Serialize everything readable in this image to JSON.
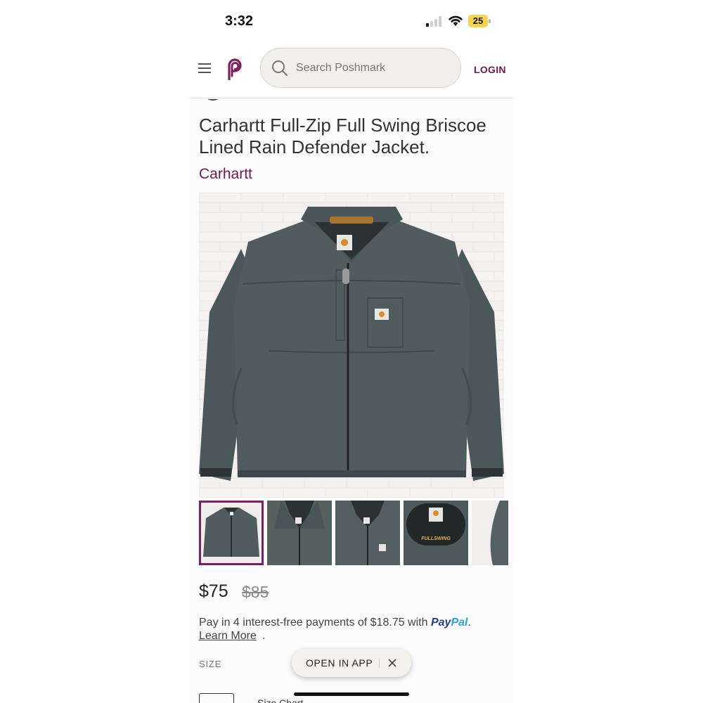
{
  "status_bar": {
    "time": "3:32",
    "battery": "25"
  },
  "header": {
    "search_placeholder": "Search Poshmark",
    "login_label": "LOGIN"
  },
  "listing": {
    "title": "Carhartt Full-Zip Full Swing Briscoe Lined Rain Defender Jacket.",
    "brand": "Carhartt",
    "price": "$75",
    "original_price": "$85",
    "installment_text": "Pay in 4 interest-free payments of $18.75 with",
    "paypal_part1": "Pay",
    "paypal_part2": "Pal",
    "installment_end": ".",
    "learn_more": "Learn More",
    "learn_more_end": ".",
    "size_label": "SIZE",
    "size_chart": "Size Chart",
    "thumbnail_label": "FULLSWING"
  },
  "banner": {
    "open_in_app": "OPEN IN APP"
  },
  "colors": {
    "accent": "#6e1a4f",
    "paypal_dark": "#233e8b",
    "paypal_light": "#2aa1e0",
    "jacket": "#4f5a5c"
  }
}
